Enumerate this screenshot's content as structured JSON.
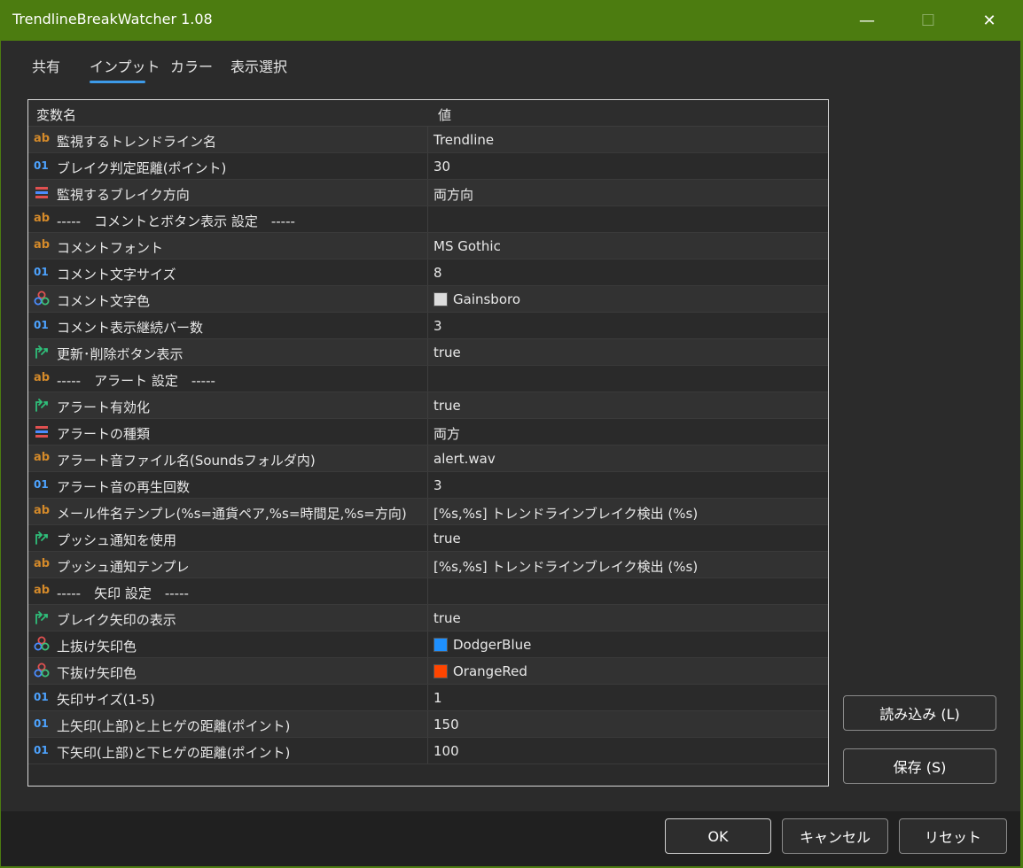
{
  "window": {
    "title": "TrendlineBreakWatcher 1.08",
    "minimize": "—",
    "maximize": "☐",
    "close": "✕"
  },
  "tabs": [
    {
      "label": "共有"
    },
    {
      "label": "インプット",
      "active": true
    },
    {
      "label": "カラー"
    },
    {
      "label": "表示選択"
    }
  ],
  "grid": {
    "header_name": "変数名",
    "header_value": "値",
    "rows": [
      {
        "icon": "string-icon",
        "name": "監視するトレンドライン名",
        "value": "Trendline"
      },
      {
        "icon": "integer-icon",
        "name": "ブレイク判定距離(ポイント)",
        "value": "30"
      },
      {
        "icon": "enum-icon",
        "name": "監視するブレイク方向",
        "value": "両方向"
      },
      {
        "icon": "string-icon",
        "name": "-----　コメントとボタン表示 設定　-----",
        "value": ""
      },
      {
        "icon": "string-icon",
        "name": "コメントフォント",
        "value": "MS Gothic"
      },
      {
        "icon": "integer-icon",
        "name": "コメント文字サイズ",
        "value": "8"
      },
      {
        "icon": "color-icon",
        "name": "コメント文字色",
        "value": "Gainsboro",
        "color": "#dcdcdc"
      },
      {
        "icon": "integer-icon",
        "name": "コメント表示継続バー数",
        "value": "3"
      },
      {
        "icon": "bool-icon",
        "name": "更新･削除ボタン表示",
        "value": "true"
      },
      {
        "icon": "string-icon",
        "name": "-----　アラート 設定　-----",
        "value": ""
      },
      {
        "icon": "bool-icon",
        "name": "アラート有効化",
        "value": "true"
      },
      {
        "icon": "enum-icon",
        "name": "アラートの種類",
        "value": "両方"
      },
      {
        "icon": "string-icon",
        "name": "アラート音ファイル名(Soundsフォルダ内)",
        "value": "alert.wav"
      },
      {
        "icon": "integer-icon",
        "name": "アラート音の再生回数",
        "value": "3"
      },
      {
        "icon": "string-icon",
        "name": "メール件名テンプレ(%s=通貨ペア,%s=時間足,%s=方向)",
        "value": "[%s,%s] トレンドラインブレイク検出 (%s)"
      },
      {
        "icon": "bool-icon",
        "name": "プッシュ通知を使用",
        "value": "true"
      },
      {
        "icon": "string-icon",
        "name": "プッシュ通知テンプレ",
        "value": "[%s,%s] トレンドラインブレイク検出 (%s)"
      },
      {
        "icon": "string-icon",
        "name": "-----　矢印 設定　-----",
        "value": ""
      },
      {
        "icon": "bool-icon",
        "name": "ブレイク矢印の表示",
        "value": "true"
      },
      {
        "icon": "color-icon",
        "name": "上抜け矢印色",
        "value": "DodgerBlue",
        "color": "#1e90ff"
      },
      {
        "icon": "color-icon",
        "name": "下抜け矢印色",
        "value": "OrangeRed",
        "color": "#ff4500"
      },
      {
        "icon": "integer-icon",
        "name": "矢印サイズ(1-5)",
        "value": "1"
      },
      {
        "icon": "integer-icon",
        "name": "上矢印(上部)と上ヒゲの距離(ポイント)",
        "value": "150"
      },
      {
        "icon": "integer-icon",
        "name": "下矢印(上部)と下ヒゲの距離(ポイント)",
        "value": "100"
      }
    ]
  },
  "buttons": {
    "load": "読み込み (L)",
    "save": "保存 (S)",
    "ok": "OK",
    "cancel": "キャンセル",
    "reset": "リセット"
  },
  "colors": {
    "titlebar": "#4c7c10",
    "tab_accent": "#3d9be9",
    "string_icon": "#d48a2a",
    "integer_icon": "#4da3ff"
  }
}
